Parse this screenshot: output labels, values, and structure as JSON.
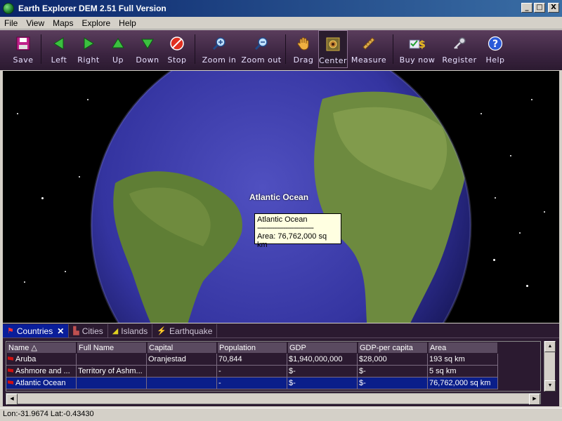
{
  "window": {
    "title": "Earth Explorer DEM 2.51 Full Version",
    "buttons": {
      "minimize": "_",
      "maximize": "□",
      "close": "X"
    }
  },
  "menu": [
    "File",
    "View",
    "Maps",
    "Explore",
    "Help"
  ],
  "toolbar": {
    "save": "Save",
    "left": "Left",
    "right": "Right",
    "up": "Up",
    "down": "Down",
    "stop": "Stop",
    "zoom_in": "Zoom in",
    "zoom_out": "Zoom out",
    "drag": "Drag",
    "center": "Center",
    "measure": "Measure",
    "buy_now": "Buy now",
    "register": "Register",
    "help": "Help"
  },
  "map": {
    "label": "Atlantic Ocean",
    "tooltip": {
      "name": "Atlantic Ocean",
      "divider": "------------------------------",
      "area": "Area: 76,762,000 sq km"
    }
  },
  "tabs": {
    "countries": "Countries",
    "cities": "Cities",
    "islands": "Islands",
    "earthquake": "Earthquake",
    "close_glyph": "✕"
  },
  "grid": {
    "columns": [
      "Name △",
      "Full Name",
      "Capital",
      "Population",
      "GDP",
      "GDP-per capita",
      "Area"
    ],
    "rows": [
      [
        "Aruba",
        "",
        "Oranjestad",
        "70,844",
        "$1,940,000,000",
        "$28,000",
        "193 sq km"
      ],
      [
        "Ashmore and ...",
        "Territory of Ashm...",
        "",
        "-",
        "$-",
        "$-",
        "5 sq km"
      ],
      [
        "Atlantic Ocean",
        "",
        "",
        "-",
        "$-",
        "$-",
        "76,762,000 sq km"
      ]
    ]
  },
  "status": {
    "coords": "Lon:-31.9674 Lat:-0.43430"
  },
  "colors": {
    "toolbar_bg": "#3b2440",
    "ocean": "#3a3aa0",
    "land": "#6d8a3f",
    "selected_row": "#0a1e8a"
  }
}
